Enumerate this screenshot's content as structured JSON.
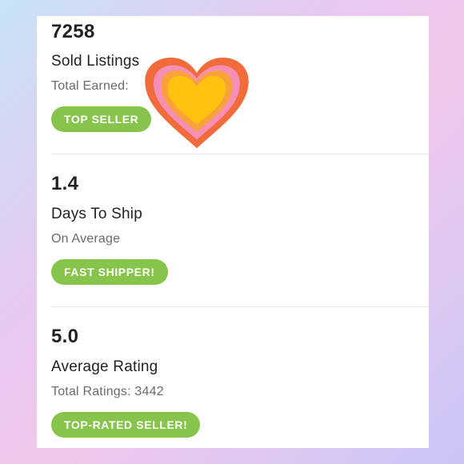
{
  "stats": [
    {
      "value": "7258",
      "title": "Sold Listings",
      "subtitle": "Total Earned:",
      "badge": "TOP SELLER"
    },
    {
      "value": "1.4",
      "title": "Days To Ship",
      "subtitle": "On Average",
      "badge": "FAST SHIPPER!"
    },
    {
      "value": "5.0",
      "title": "Average Rating",
      "subtitle": "Total Ratings: 3442",
      "badge": "TOP-RATED SELLER!"
    }
  ],
  "colors": {
    "badge_green": "#87c44b",
    "heart_outer": "#f26b3a",
    "heart_pink": "#f58fb5",
    "heart_orange": "#f9a23c",
    "heart_yellow": "#ffc20e"
  },
  "sticker": {
    "icon": "heart-sticker-icon"
  }
}
